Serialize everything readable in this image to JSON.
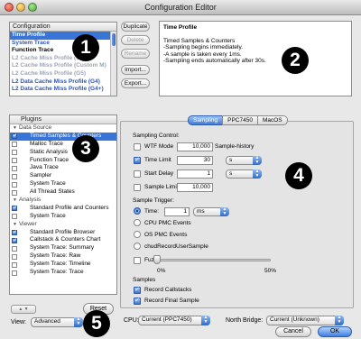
{
  "window": {
    "title": "Configuration Editor"
  },
  "config_list": {
    "header": "Configuration",
    "items": [
      {
        "label": "Time Profile",
        "state": "selected"
      },
      {
        "label": "System Trace",
        "state": "blue"
      },
      {
        "label": "Function Trace",
        "state": "normal"
      },
      {
        "label": "L2 Cache Miss Profile (G4)",
        "state": "gray"
      },
      {
        "label": "L2 Cache Miss Profile (Custom M)",
        "state": "gray"
      },
      {
        "label": "L2 Cache Miss Profile (G5)",
        "state": "gray"
      },
      {
        "label": "L2 Data Cache Miss Profile (G4)",
        "state": "blue"
      },
      {
        "label": "L2 Data Cache Miss Profile (G4+)",
        "state": "blue"
      }
    ]
  },
  "side_buttons": {
    "duplicate": "Duplicate",
    "delete": "Delete",
    "rename": "Rename",
    "import": "Import...",
    "export": "Export..."
  },
  "description": {
    "title": "Time Profile",
    "lines": [
      "Timed Samples & Counters",
      "-Sampling begins immediately.",
      "-A sample is taken every 1ms.",
      "-Sampling ends automatically after 30s."
    ]
  },
  "plugins": {
    "header": "Plugins",
    "rows": [
      {
        "type": "group",
        "label": "Data Source"
      },
      {
        "type": "item",
        "label": "Timed Samples & Counters",
        "checked": true,
        "selected": true
      },
      {
        "type": "item",
        "label": "Malloc Trace",
        "checked": false
      },
      {
        "type": "item",
        "label": "Static Analysis",
        "checked": false
      },
      {
        "type": "item",
        "label": "Function Trace",
        "checked": false
      },
      {
        "type": "item",
        "label": "Java Trace",
        "checked": false
      },
      {
        "type": "item",
        "label": "Sampler",
        "checked": false
      },
      {
        "type": "item",
        "label": "System Trace",
        "checked": false
      },
      {
        "type": "item",
        "label": "All Thread States",
        "checked": false
      },
      {
        "type": "group",
        "label": "Analysis"
      },
      {
        "type": "item",
        "label": "Standard Profile and Counters",
        "checked": true
      },
      {
        "type": "item",
        "label": "System Trace",
        "checked": false
      },
      {
        "type": "group",
        "label": "Viewer"
      },
      {
        "type": "item",
        "label": "Standard Profile Browser",
        "checked": true
      },
      {
        "type": "item",
        "label": "Callstack & Counters Chart",
        "checked": true
      },
      {
        "type": "item",
        "label": "System Trace: Summary",
        "checked": false
      },
      {
        "type": "item",
        "label": "System Trace: Raw",
        "checked": false
      },
      {
        "type": "item",
        "label": "System Trace: Timeline",
        "checked": false
      },
      {
        "type": "item",
        "label": "System Trace: Trace",
        "checked": false
      }
    ]
  },
  "tabs": [
    "Sampling",
    "PPC7450",
    "MacOS"
  ],
  "sampling": {
    "control_label": "Sampling Control:",
    "wtf_mode_label": "WTF Mode",
    "wtf_mode_value": "10,000",
    "wtf_mode_suffix": "Sample-history",
    "time_limit_label": "Time Limit",
    "time_limit_value": "30",
    "time_limit_unit": "s",
    "start_delay_label": "Start Delay",
    "start_delay_value": "1",
    "start_delay_unit": "s",
    "sample_limit_label": "Sample Limit",
    "sample_limit_value": "10,000",
    "trigger_label": "Sample Trigger:",
    "time_trigger_label": "Time:",
    "time_trigger_value": "1",
    "time_trigger_unit": "ms",
    "cpu_pmc_label": "CPU PMC Events",
    "os_pmc_label": "OS PMC Events",
    "chud_label": "chudRecordUserSample",
    "fuzz_label": "Fuzz",
    "fuzz_min": "0%",
    "fuzz_max": "50%",
    "fuzz_level": 0,
    "samples_label": "Samples",
    "record_callstacks_label": "Record Callstacks",
    "record_final_label": "Record Final Sample"
  },
  "bottom": {
    "stepper": "▲ ▼",
    "reset": "Reset",
    "view_label": "View:",
    "view_value": "Advanced",
    "cpu_label": "CPU:",
    "cpu_value": "Current (PPC7450)",
    "north_bridge_label": "North Bridge:",
    "north_bridge_value": "Current (Unknown)",
    "cancel": "Cancel",
    "ok": "OK"
  },
  "badges": [
    "1",
    "2",
    "3",
    "4",
    "5"
  ]
}
